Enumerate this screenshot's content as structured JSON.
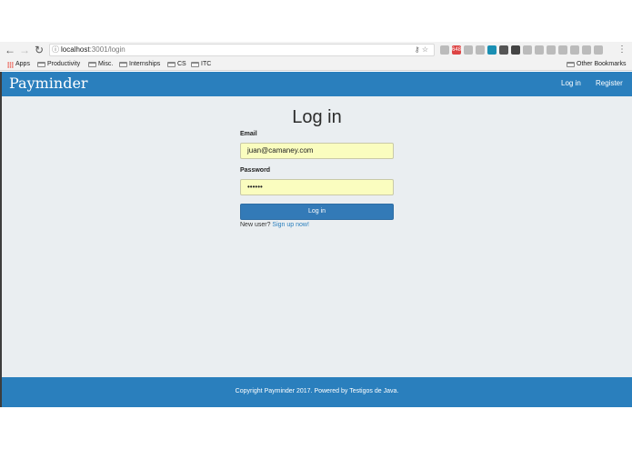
{
  "browser": {
    "url_host": "localhost",
    "url_rest": ":3001/login",
    "bookmarks": [
      "Apps",
      "Productivity",
      "Misc.",
      "Internships",
      "CS",
      "ITC"
    ],
    "other_bookmarks": "Other Bookmarks",
    "gmail_badge": "648"
  },
  "nav": {
    "brand": "Payminder",
    "login": "Log in",
    "register": "Register"
  },
  "form": {
    "title": "Log in",
    "email_label": "Email",
    "email_value": "juan@camaney.com",
    "password_label": "Password",
    "password_value": "••••••",
    "submit": "Log in",
    "new_user": "New user?",
    "signup": "Sign up now!"
  },
  "footer": {
    "text": "Copyright Payminder 2017. Powered by Testigos de Java."
  },
  "colors": {
    "brand_blue": "#2a7fbd",
    "button_blue": "#337ab7",
    "page_bg": "#eaeef1",
    "autofill_yellow": "#fafdbf"
  }
}
